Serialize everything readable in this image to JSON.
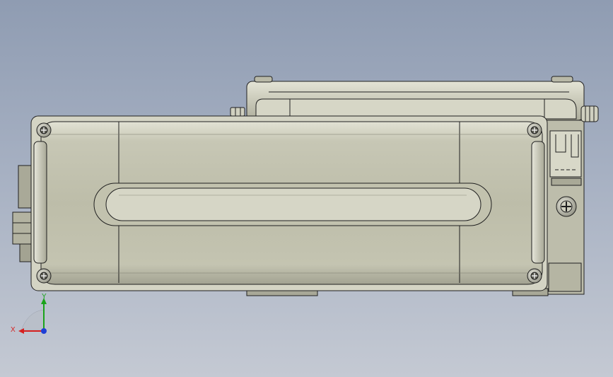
{
  "triad": {
    "x_label": "X",
    "y_label": "Y"
  },
  "colors": {
    "background_top": "#8f9cb2",
    "background_bottom": "#c4c9d3",
    "part_face": "#c9c9b8",
    "part_edge": "#202020",
    "axis_x": "#d62020",
    "axis_y": "#1aa31a",
    "axis_z": "#1f3fd6"
  },
  "icons": [
    "screw-icon",
    "nut-icon",
    "cross-screw-icon",
    "view-triad-icon"
  ]
}
